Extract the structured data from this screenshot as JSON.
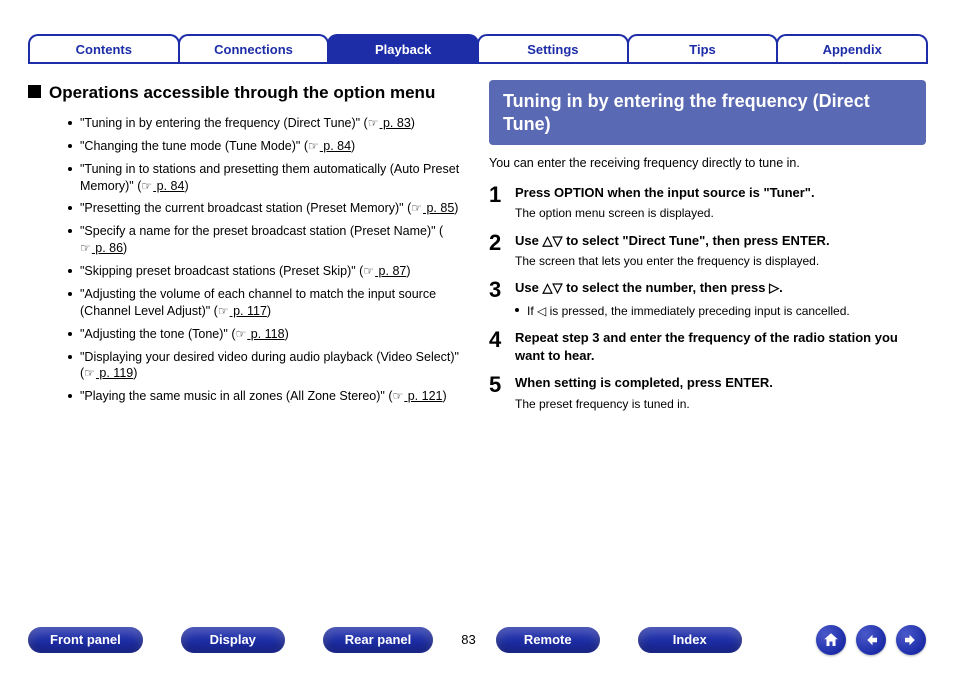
{
  "tabs": {
    "items": [
      {
        "label": "Contents",
        "active": false
      },
      {
        "label": "Connections",
        "active": false
      },
      {
        "label": "Playback",
        "active": true
      },
      {
        "label": "Settings",
        "active": false
      },
      {
        "label": "Tips",
        "active": false
      },
      {
        "label": "Appendix",
        "active": false
      }
    ]
  },
  "left": {
    "heading": "Operations accessible through the option menu",
    "items": [
      {
        "text": "\"Tuning in by entering the frequency (Direct Tune)\" (",
        "page": "p. 83",
        "tail": ")"
      },
      {
        "text": "\"Changing the tune mode (Tune Mode)\" (",
        "page": "p. 84",
        "tail": ")"
      },
      {
        "text": "\"Tuning in to stations and presetting them automatically (Auto Preset Memory)\" (",
        "page": "p. 84",
        "tail": ")"
      },
      {
        "text": "\"Presetting the current broadcast station (Preset Memory)\" (",
        "page": "p. 85",
        "tail": ")"
      },
      {
        "text": "\"Specify a name for the preset broadcast station (Preset Name)\" (",
        "page": "p. 86",
        "tail": ")"
      },
      {
        "text": "\"Skipping preset broadcast stations (Preset Skip)\" (",
        "page": "p. 87",
        "tail": ")"
      },
      {
        "text": "\"Adjusting the volume of each channel to match the input source (Channel Level Adjust)\" (",
        "page": "p. 117",
        "tail": ")"
      },
      {
        "text": "\"Adjusting the tone (Tone)\" (",
        "page": "p. 118",
        "tail": ")"
      },
      {
        "text": "\"Displaying your desired video during audio playback (Video Select)\" (",
        "page": "p. 119",
        "tail": ")"
      },
      {
        "text": "\"Playing the same music in all zones (All Zone Stereo)\" (",
        "page": "p. 121",
        "tail": ")"
      }
    ]
  },
  "right": {
    "title": "Tuning in by entering the frequency (Direct Tune)",
    "intro": "You can enter the receiving frequency directly to tune in.",
    "steps": [
      {
        "num": "1",
        "title": "Press OPTION when the input source is \"Tuner\".",
        "sub": "The option menu screen is displayed."
      },
      {
        "num": "2",
        "title_html": "Use <span class='sym'>△▽</span> to select \"Direct Tune\", then press ENTER.",
        "sub": "The screen that lets you enter the frequency is displayed."
      },
      {
        "num": "3",
        "title_html": "Use <span class='sym'>△▽</span> to select the number, then press <span class='sym'>▷</span>.",
        "note_html": "If <span class='sym'>◁</span> is pressed, the immediately preceding input is cancelled."
      },
      {
        "num": "4",
        "title": "Repeat step 3 and enter the frequency of the radio station you want to hear."
      },
      {
        "num": "5",
        "title": "When setting is completed, press ENTER.",
        "sub": "The preset frequency is tuned in."
      }
    ]
  },
  "footer": {
    "buttons": [
      "Front panel",
      "Display",
      "Rear panel",
      "Remote",
      "Index"
    ],
    "page_num": "83",
    "nav": {
      "home": "home-icon",
      "prev": "arrow-left-icon",
      "next": "arrow-right-icon"
    }
  }
}
